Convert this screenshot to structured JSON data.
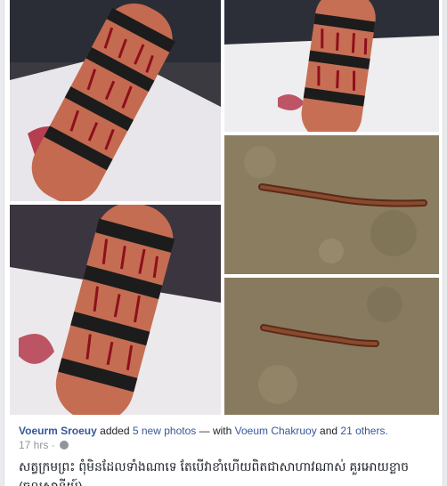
{
  "post": {
    "author": "Voeurm Sroeuy",
    "action_prefix": "added",
    "photos_link": "5 new photos",
    "with_text": "— with",
    "tagged_user": "Voeum Chakruoy",
    "and_text": "and",
    "others_link": "21 others.",
    "timestamp": "17 hrs",
    "privacy_icon": "globe-icon",
    "caption_line1": "សត្វក្រមព្រះ ពុំមិនដែលទាំងណាទេ តែបើវាខាំហើយពិតជាសាហាវណាស់ គួរអោយខ្លាច",
    "caption_line2": "(ចូលស្ថានីយ៍)"
  },
  "photos": [
    {
      "name": "photo-leg-bandaged-1",
      "icon": "image-icon"
    },
    {
      "name": "photo-leg-bandaged-2",
      "icon": "image-icon"
    },
    {
      "name": "photo-leg-bandaged-3",
      "icon": "image-icon"
    },
    {
      "name": "photo-millipede-1",
      "icon": "image-icon"
    },
    {
      "name": "photo-millipede-2",
      "icon": "image-icon"
    }
  ],
  "colors": {
    "link": "#365899",
    "text": "#1d2129",
    "muted": "#90949c",
    "page_bg": "#e9ebee"
  }
}
